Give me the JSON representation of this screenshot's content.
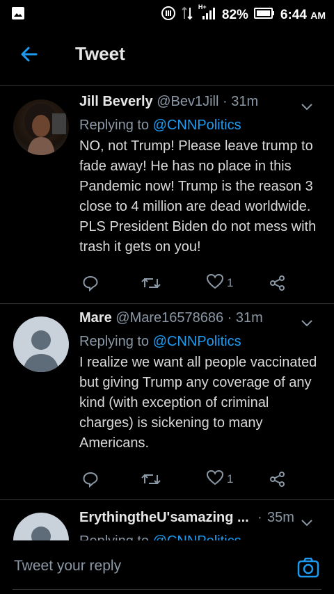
{
  "status_bar": {
    "network": "H+",
    "battery": "82%",
    "time": "6:44",
    "ampm": "AM"
  },
  "app_bar": {
    "title": "Tweet"
  },
  "tweets": [
    {
      "name": "Jill Beverly",
      "handle": "@Bev1Jill",
      "time": "31m",
      "replying_prefix": "Replying to",
      "replying_to": "@CNNPolitics",
      "text": "NO, not Trump! Please leave trump to fade away! He has no place in this Pandemic now! Trump is the reason 3 close to 4 million are dead worldwide. PLS President Biden do not mess with trash it gets on you!",
      "likes": "1"
    },
    {
      "name": "Mare",
      "handle": "@Mare16578686",
      "time": "31m",
      "replying_prefix": "Replying to",
      "replying_to": "@CNNPolitics",
      "text": "I realize we want all people vaccinated but giving Trump any coverage of any kind (with exception of criminal charges) is sickening to many Americans.",
      "likes": "1"
    },
    {
      "name": "ErythingtheU'samazing ...",
      "handle": "",
      "time": "35m",
      "replying_prefix": "Replying to",
      "replying_to": "@CNNPolitics"
    }
  ],
  "composer": {
    "placeholder": "Tweet your reply"
  },
  "colors": {
    "accent": "#1d9bf0",
    "muted": "#8b98a5",
    "background": "#000000"
  }
}
